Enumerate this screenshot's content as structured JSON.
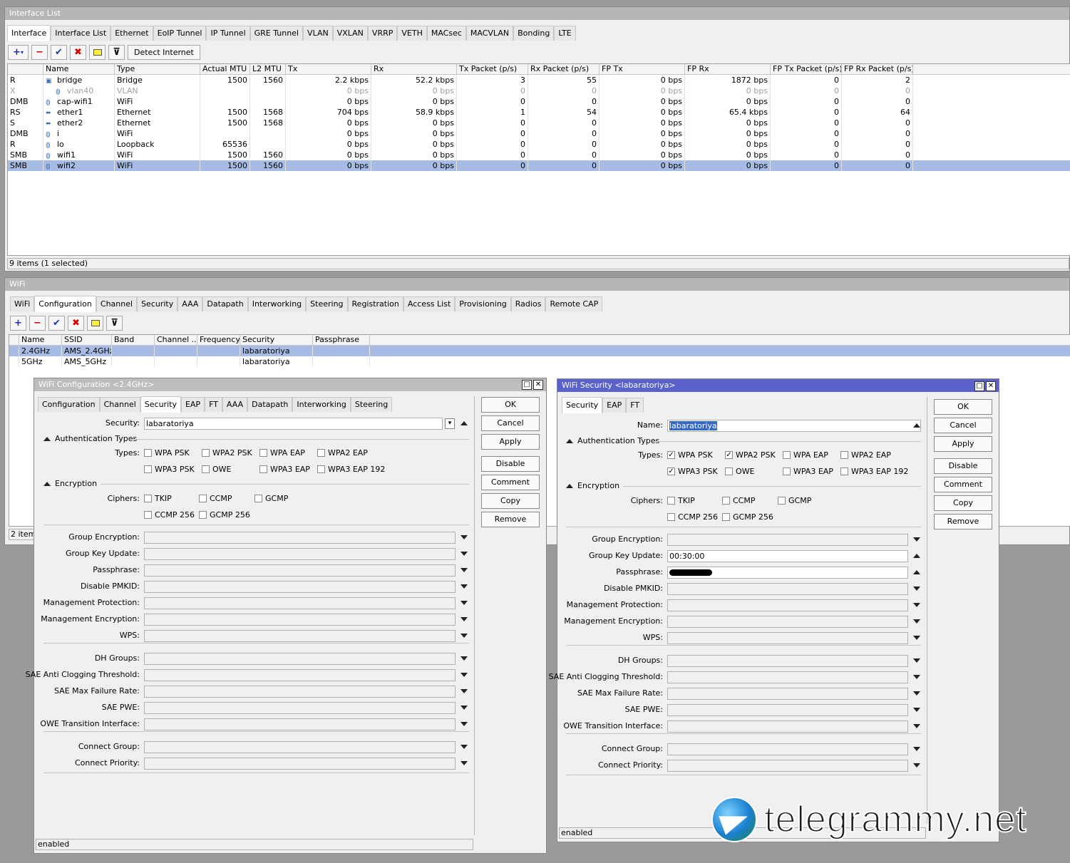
{
  "iface": {
    "title": "Interface List",
    "tabs": [
      "Interface",
      "Interface List",
      "Ethernet",
      "EoIP Tunnel",
      "IP Tunnel",
      "GRE Tunnel",
      "VLAN",
      "VXLAN",
      "VRRP",
      "VETH",
      "MACsec",
      "MACVLAN",
      "Bonding",
      "LTE"
    ],
    "detect": "Detect Internet",
    "headers": [
      "",
      "Name",
      "Type",
      "Actual MTU",
      "L2 MTU",
      "Tx",
      "Rx",
      "Tx Packet (p/s)",
      "Rx Packet (p/s)",
      "FP Tx",
      "FP Rx",
      "FP Tx Packet (p/s)",
      "FP Rx Packet (p/s)"
    ],
    "rows": [
      [
        "R",
        "bridge",
        "Bridge",
        "1500",
        "1560",
        "2.2 kbps",
        "52.2 kbps",
        "3",
        "55",
        "0 bps",
        "1872 bps",
        "0",
        "2"
      ],
      [
        "X",
        "vlan40",
        "VLAN",
        "",
        "",
        "0 bps",
        "0 bps",
        "0",
        "0",
        "0 bps",
        "0 bps",
        "0",
        "0"
      ],
      [
        "DMB",
        "cap-wifi1",
        "WiFi",
        "",
        "",
        "0 bps",
        "0 bps",
        "0",
        "0",
        "0 bps",
        "0 bps",
        "0",
        "0"
      ],
      [
        "RS",
        "ether1",
        "Ethernet",
        "1500",
        "1568",
        "704 bps",
        "58.9 kbps",
        "1",
        "54",
        "0 bps",
        "65.4 kbps",
        "0",
        "64"
      ],
      [
        "S",
        "ether2",
        "Ethernet",
        "1500",
        "1568",
        "0 bps",
        "0 bps",
        "0",
        "0",
        "0 bps",
        "0 bps",
        "0",
        "0"
      ],
      [
        "DMB",
        "i",
        "WiFi",
        "",
        "",
        "0 bps",
        "0 bps",
        "0",
        "0",
        "0 bps",
        "0 bps",
        "0",
        "0"
      ],
      [
        "R",
        "lo",
        "Loopback",
        "65536",
        "",
        "0 bps",
        "0 bps",
        "0",
        "0",
        "0 bps",
        "0 bps",
        "0",
        "0"
      ],
      [
        "SMB",
        "wifi1",
        "WiFi",
        "1500",
        "1560",
        "0 bps",
        "0 bps",
        "0",
        "0",
        "0 bps",
        "0 bps",
        "0",
        "0"
      ],
      [
        "SMB",
        "wifi2",
        "WiFi",
        "1500",
        "1560",
        "0 bps",
        "0 bps",
        "0",
        "0",
        "0 bps",
        "0 bps",
        "0",
        "0"
      ]
    ],
    "status": "9 items (1 selected)"
  },
  "wifi": {
    "title": "WiFi",
    "tabs": [
      "WiFi",
      "Configuration",
      "Channel",
      "Security",
      "AAA",
      "Datapath",
      "Interworking",
      "Steering",
      "Registration",
      "Access List",
      "Provisioning",
      "Radios",
      "Remote CAP"
    ],
    "headers": [
      "Name",
      "SSID",
      "Band",
      "Channel ...",
      "Frequency",
      "Security",
      "Passphrase"
    ],
    "rows": [
      [
        "2.4GHz",
        "AMS_2.4GHz",
        "",
        "",
        "",
        "labaratoriya",
        ""
      ],
      [
        "5GHz",
        "AMS_5GHz",
        "",
        "",
        "",
        "labaratoriya",
        ""
      ]
    ],
    "status": "2 items"
  },
  "cfg": {
    "title": "WiFi Configuration <2.4GHz>",
    "tabs": [
      "Configuration",
      "Channel",
      "Security",
      "EAP",
      "FT",
      "AAA",
      "Datapath",
      "Interworking",
      "Steering"
    ],
    "security_label": "Security:",
    "security_value": "labaratoriya",
    "status": "enabled"
  },
  "sec": {
    "title": "WiFi Security <labaratoriya>",
    "tabs": [
      "Security",
      "EAP",
      "FT"
    ],
    "name_label": "Name:",
    "name_value": "labaratoriya",
    "gku_value": "00:30:00",
    "status": "enabled"
  },
  "common": {
    "auth": "Authentication Types",
    "types": "Types:",
    "enc": "Encryption",
    "ciphers": "Ciphers:",
    "t": [
      "WPA PSK",
      "WPA2 PSK",
      "WPA EAP",
      "WPA2 EAP",
      "WPA3 PSK",
      "OWE",
      "WPA3 EAP",
      "WPA3 EAP 192"
    ],
    "c": [
      "TKIP",
      "CCMP",
      "GCMP",
      "CCMP 256",
      "GCMP 256"
    ],
    "f1": [
      "Group Encryption:",
      "Group Key Update:",
      "Passphrase:",
      "Disable PMKID:",
      "Management Protection:",
      "Management Encryption:",
      "WPS:"
    ],
    "f2": [
      "DH Groups:",
      "SAE Anti Clogging Threshold:",
      "SAE Max Failure Rate:",
      "SAE PWE:",
      "OWE Transition Interface:"
    ],
    "f3": [
      "Connect Group:",
      "Connect Priority:"
    ],
    "buttons": [
      "OK",
      "Cancel",
      "Apply",
      "Disable",
      "Comment",
      "Copy",
      "Remove"
    ]
  },
  "watermark": "telegrammy.net"
}
